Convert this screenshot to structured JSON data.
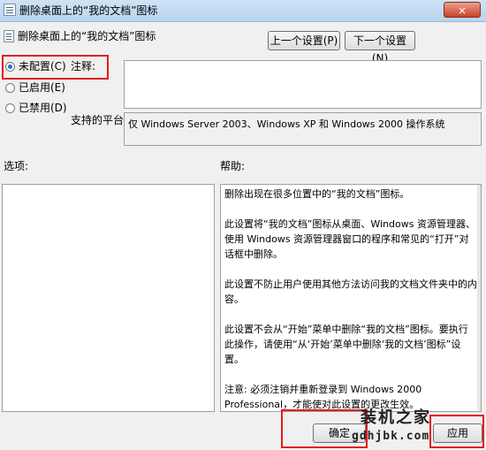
{
  "window": {
    "title": "删除桌面上的“我的文档”图标",
    "close_label": "×"
  },
  "header": {
    "policy_title": "删除桌面上的“我的文档”图标"
  },
  "nav": {
    "prev_label": "上一个设置(P)",
    "next_label": "下一个设置(N)"
  },
  "state": {
    "options": [
      {
        "label": "未配置(C)",
        "selected": true
      },
      {
        "label": "已启用(E)",
        "selected": false
      },
      {
        "label": "已禁用(D)",
        "selected": false
      }
    ]
  },
  "comment": {
    "label": "注释:",
    "value": ""
  },
  "platform": {
    "label": "支持的平台:",
    "value": "仅 Windows Server 2003、Windows XP 和 Windows 2000 操作系统"
  },
  "options_section": {
    "label": "选项:"
  },
  "help_section": {
    "label": "帮助:",
    "paragraphs": [
      "删除出现在很多位置中的“我的文档”图标。",
      "此设置将“我的文档”图标从桌面、Windows 资源管理器、使用 Windows 资源管理器窗口的程序和常见的“打开”对话框中删除。",
      "此设置不防止用户使用其他方法访问我的文档文件夹中的内容。",
      "此设置不会从“开始”菜单中删除“我的文档”图标。要执行此操作，请使用“从‘开始’菜单中删除‘我的文档’图标”设置。",
      "注意: 必须注销并重新登录到 Windows 2000 Professional，才能使对此设置的更改生效。"
    ]
  },
  "footer": {
    "ok_label": "确定",
    "apply_label": "应用"
  },
  "watermark": {
    "text": "装机之家",
    "url": "gdhjbk.com"
  },
  "colors": {
    "highlight": "#e01c1c",
    "accent": "#2a6ad8"
  }
}
